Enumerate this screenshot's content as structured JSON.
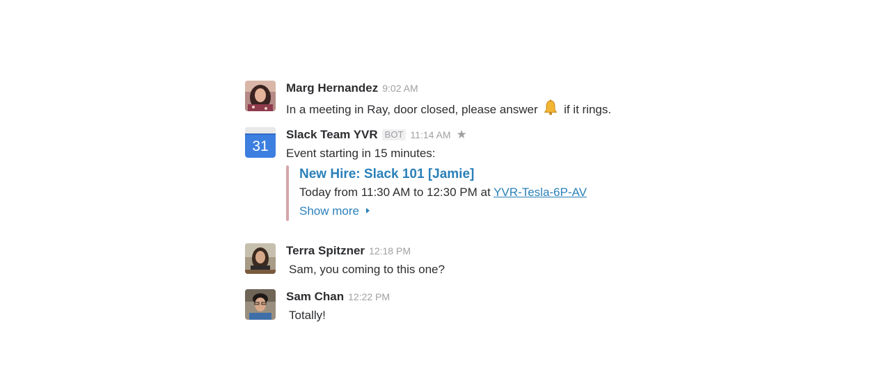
{
  "messages": [
    {
      "sender": "Marg Hernandez",
      "time": "9:02 AM",
      "text_before": "In a meeting in Ray, door closed, please answer",
      "emoji": "bell-icon",
      "text_after": "if it rings."
    },
    {
      "sender": "Slack Team YVR",
      "badge": "BOT",
      "time": "11:14 AM",
      "avatar_text": "31",
      "text": "Event starting in 15 minutes:",
      "attachment": {
        "title": "New Hire: Slack 101 [Jamie]",
        "detail_prefix": "Today from 11:30 AM to 12:30 PM at",
        "location_link": "YVR-Tesla-6P-AV",
        "show_more": "Show more",
        "accent_color": "#d6a5aa"
      }
    },
    {
      "sender": "Terra Spitzner",
      "time": "12:18 PM",
      "text": "Sam, you coming to this one?"
    },
    {
      "sender": "Sam Chan",
      "time": "12:22 PM",
      "text": "Totally!"
    }
  ],
  "colors": {
    "link": "#2a80b9",
    "timestamp": "#a0a0a2",
    "text": "#2c2d30",
    "calendar_blue": "#3d7fe0"
  }
}
